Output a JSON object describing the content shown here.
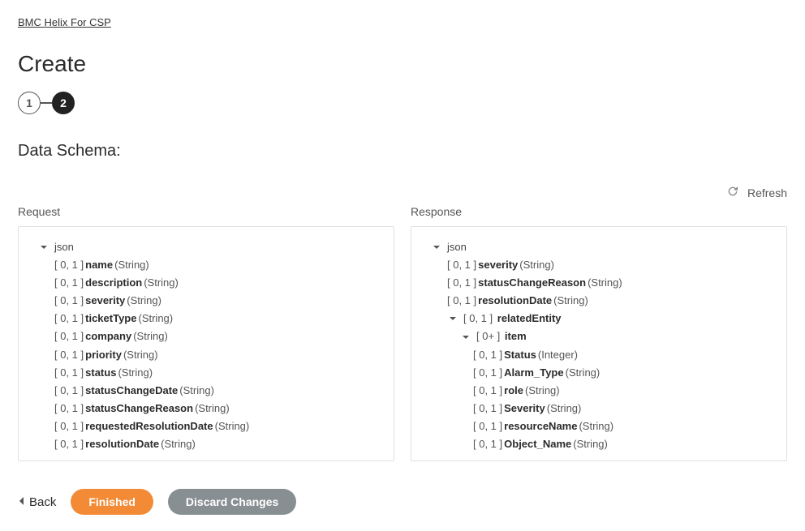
{
  "breadcrumb": {
    "label": "BMC Helix For CSP"
  },
  "page": {
    "title": "Create"
  },
  "stepper": {
    "steps": [
      "1",
      "2"
    ],
    "active_index": 1
  },
  "schema": {
    "heading": "Data Schema:",
    "refresh_label": "Refresh",
    "request_label": "Request",
    "response_label": "Response",
    "root_label": "json",
    "request_fields": [
      {
        "card": "[ 0, 1 ]",
        "name": "name",
        "type": "(String)"
      },
      {
        "card": "[ 0, 1 ]",
        "name": "description",
        "type": "(String)"
      },
      {
        "card": "[ 0, 1 ]",
        "name": "severity",
        "type": "(String)"
      },
      {
        "card": "[ 0, 1 ]",
        "name": "ticketType",
        "type": "(String)"
      },
      {
        "card": "[ 0, 1 ]",
        "name": "company",
        "type": "(String)"
      },
      {
        "card": "[ 0, 1 ]",
        "name": "priority",
        "type": "(String)"
      },
      {
        "card": "[ 0, 1 ]",
        "name": "status",
        "type": "(String)"
      },
      {
        "card": "[ 0, 1 ]",
        "name": "statusChangeDate",
        "type": "(String)"
      },
      {
        "card": "[ 0, 1 ]",
        "name": "statusChangeReason",
        "type": "(String)"
      },
      {
        "card": "[ 0, 1 ]",
        "name": "requestedResolutionDate",
        "type": "(String)"
      },
      {
        "card": "[ 0, 1 ]",
        "name": "resolutionDate",
        "type": "(String)"
      }
    ],
    "response_fields_top": [
      {
        "card": "[ 0, 1 ]",
        "name": "severity",
        "type": "(String)"
      },
      {
        "card": "[ 0, 1 ]",
        "name": "statusChangeReason",
        "type": "(String)"
      },
      {
        "card": "[ 0, 1 ]",
        "name": "resolutionDate",
        "type": "(String)"
      }
    ],
    "response_related": {
      "card": "[ 0, 1 ]",
      "name": "relatedEntity"
    },
    "response_item": {
      "card": "[ 0+ ]",
      "name": "item"
    },
    "response_item_fields": [
      {
        "card": "[ 0, 1 ]",
        "name": "Status",
        "type": "(Integer)"
      },
      {
        "card": "[ 0, 1 ]",
        "name": "Alarm_Type",
        "type": "(String)"
      },
      {
        "card": "[ 0, 1 ]",
        "name": "role",
        "type": "(String)"
      },
      {
        "card": "[ 0, 1 ]",
        "name": "Severity",
        "type": "(String)"
      },
      {
        "card": "[ 0, 1 ]",
        "name": "resourceName",
        "type": "(String)"
      },
      {
        "card": "[ 0, 1 ]",
        "name": "Object_Name",
        "type": "(String)"
      }
    ]
  },
  "footer": {
    "back": "Back",
    "finished": "Finished",
    "discard": "Discard Changes"
  }
}
